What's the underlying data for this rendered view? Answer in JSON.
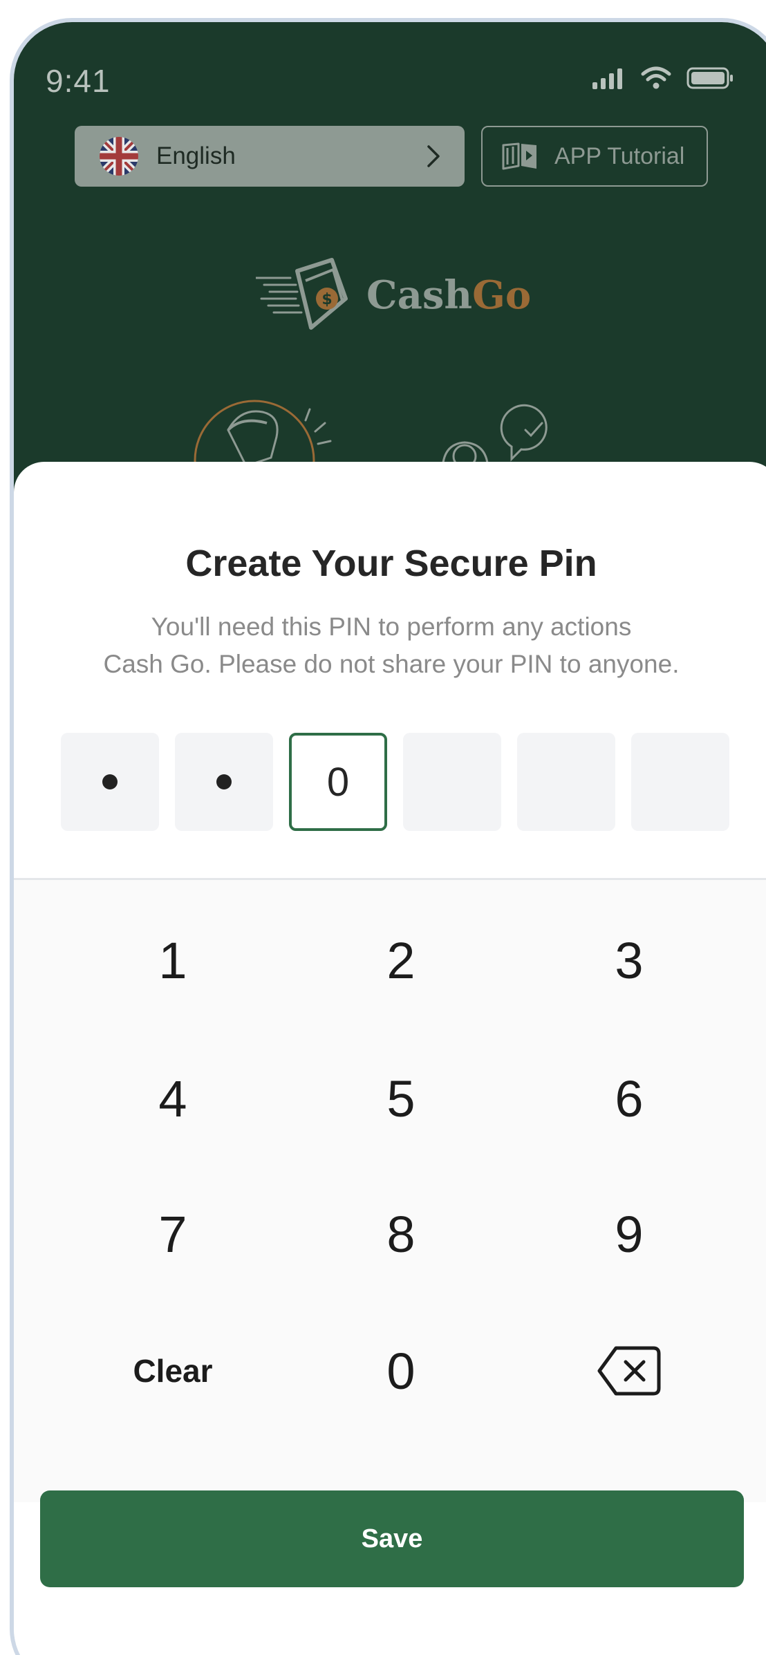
{
  "status": {
    "time": "9:41"
  },
  "header": {
    "language_label": "English",
    "tutorial_label": "APP Tutorial"
  },
  "logo": {
    "cash": "Cash",
    "go": "Go"
  },
  "pin_sheet": {
    "title": "Create Your Secure Pin",
    "subtitle_line1": "You'll need this PIN to perform any actions",
    "subtitle_line2": "Cash Go. Please do not share your PIN to anyone.",
    "pin_length": 6,
    "entered_masked": 2,
    "current_digit": "0"
  },
  "keypad": {
    "k1": "1",
    "k2": "2",
    "k3": "3",
    "k4": "4",
    "k5": "5",
    "k6": "6",
    "k7": "7",
    "k8": "8",
    "k9": "9",
    "clear": "Clear",
    "k0": "0",
    "backspace_icon": "backspace-icon"
  },
  "save_label": "Save",
  "colors": {
    "header_bg": "#1b3a2b",
    "accent": "#2f6e47",
    "logo_go": "#9a6a36"
  }
}
